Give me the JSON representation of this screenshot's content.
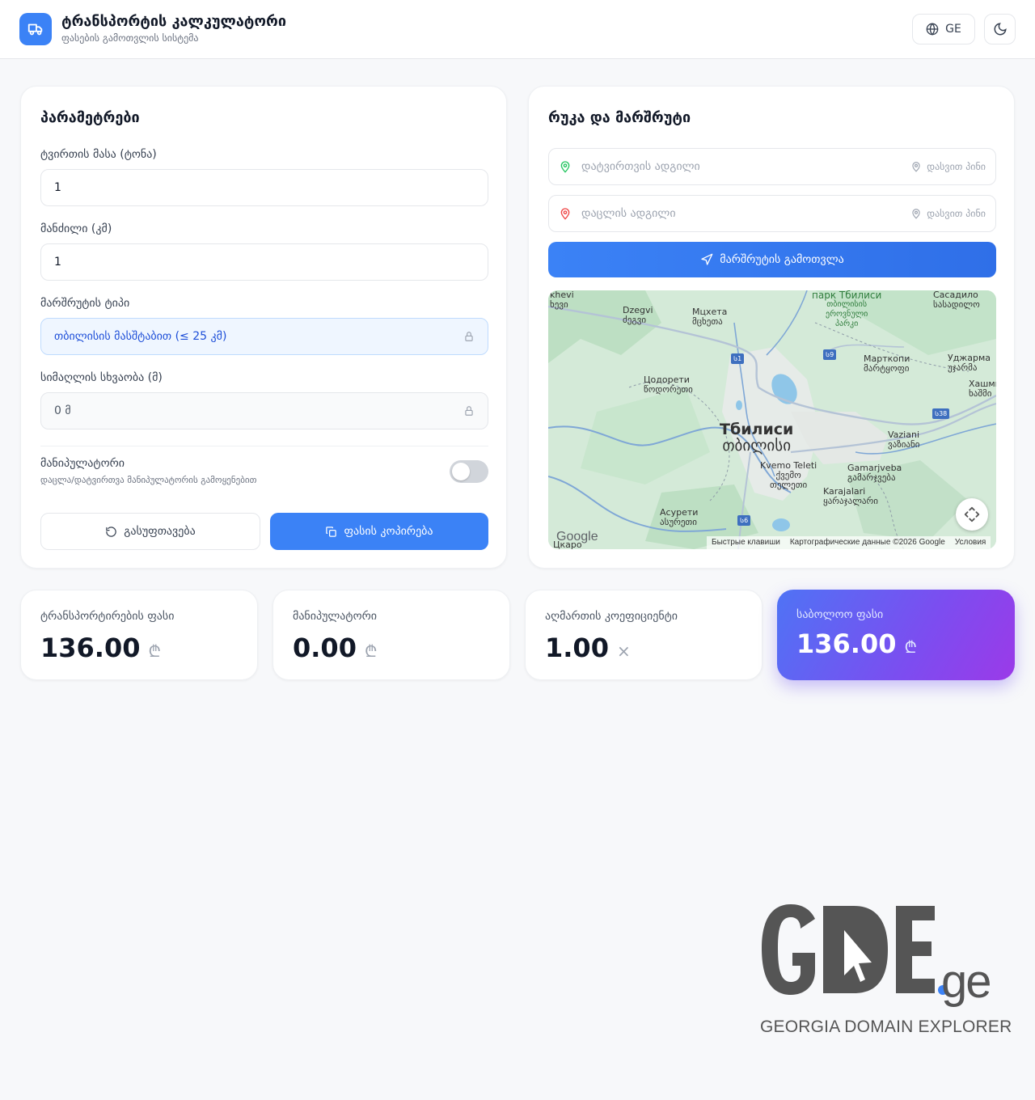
{
  "header": {
    "title": "ტრანსპორტის კალკულატორი",
    "subtitle": "ფასების გამოთვლის სისტემა",
    "lang_label": "GE"
  },
  "params": {
    "title": "პარამეტრები",
    "weight_label": "ტვირთის მასა (ტონა)",
    "weight_value": "1",
    "distance_label": "მანძილი (კმ)",
    "distance_value": "1",
    "route_type_label": "მარშრუტის ტიპი",
    "route_type_value": "თბილისის მასშტაბით (≤ 25 კმ)",
    "elevation_label": "სიმაღლის სხვაობა (მ)",
    "elevation_value": "0 მ",
    "manipulator_label": "მანიპულატორი",
    "manipulator_desc": "დაცლა/დატვირთვა მანიპულატორის გამოყენებით",
    "manipulator_on": false,
    "reset_label": "გასუფთავება",
    "copy_label": "ფასის კოპირება"
  },
  "map_panel": {
    "title": "რუკა და მარშრუტი",
    "pickup_placeholder": "დატვირთვის ადგილი",
    "dropoff_placeholder": "დაცლის ადგილი",
    "pick_pin_label": "დასვით პინი",
    "calc_button": "მარშრუტის გამოთვლა",
    "map_labels": {
      "tbilisi_ru": "Тбилиси",
      "tbilisi_ka": "თბილისი",
      "mtskheta_ru": "Мцхета",
      "mtskheta_ka": "მცხეთა",
      "dzegvi": "Dzegvi",
      "dzegvi_ka": "ძეგვი",
      "khevi": "khevi",
      "khevi_ka": "ხევი",
      "park_ru": "парк Тбилиси",
      "park_ka": "თბილისის",
      "park_ka2": "ეროვნული",
      "park_ka3": "პარკი",
      "sasadilo_ru": "Сасадило",
      "sasadilo_ka": "სასადილო",
      "martkopi_ru": "Марткопи",
      "martkopi_ka": "მარტყოფი",
      "udzharma_ru": "Уджарма",
      "udzharma_ka": "უჯარმა",
      "khashmi_ru": "Хашми",
      "khashmi_ka": "ხაშმი",
      "tsodoreti_ru": "Цодорети",
      "tsodoreti_ka": "წოდორეთი",
      "vaziani": "Vaziani",
      "vaziani_ka": "ვაზიანი",
      "kvemo_teleti": "Kvemo Teleti",
      "kvemo_teleti_ka1": "ქვემო",
      "kvemo_teleti_ka2": "თელეთი",
      "gamarjveba": "Gamarjveba",
      "gamarjveba_ka": "გამარჯვება",
      "karajalari": "Karajalari",
      "karajalari_ka": "ყარაჯალარი",
      "asureti_ru": "Асурети",
      "asureti_ka": "ასურეთი",
      "tsqaro": "Цкаро",
      "shields": [
        "Ს1",
        "Ს9",
        "Ს38",
        "Ს6"
      ],
      "google": "Google",
      "shortcuts": "Быстрые клавиши",
      "map_data": "Картографические данные ©2026 Google",
      "terms": "Условия"
    }
  },
  "stats": {
    "transport_label": "ტრანსპორტირების ფასი",
    "transport_value": "136.00",
    "transport_unit": "₾",
    "manipulator_label": "მანიპულატორი",
    "manipulator_value": "0.00",
    "manipulator_unit": "₾",
    "coef_label": "აღმართის კოეფიციენტი",
    "coef_value": "1.00",
    "coef_unit": "×",
    "final_label": "საბოლოო ფასი",
    "final_value": "136.00",
    "final_unit": "₾"
  },
  "watermark": {
    "brand": "GDE",
    "tld": ".ge",
    "tagline": "GEORGIA DOMAIN EXPLORER"
  },
  "colors": {
    "accent": "#3b82f6",
    "final_gradient_start": "#4f73f5",
    "final_gradient_end": "#9b3ae8"
  }
}
